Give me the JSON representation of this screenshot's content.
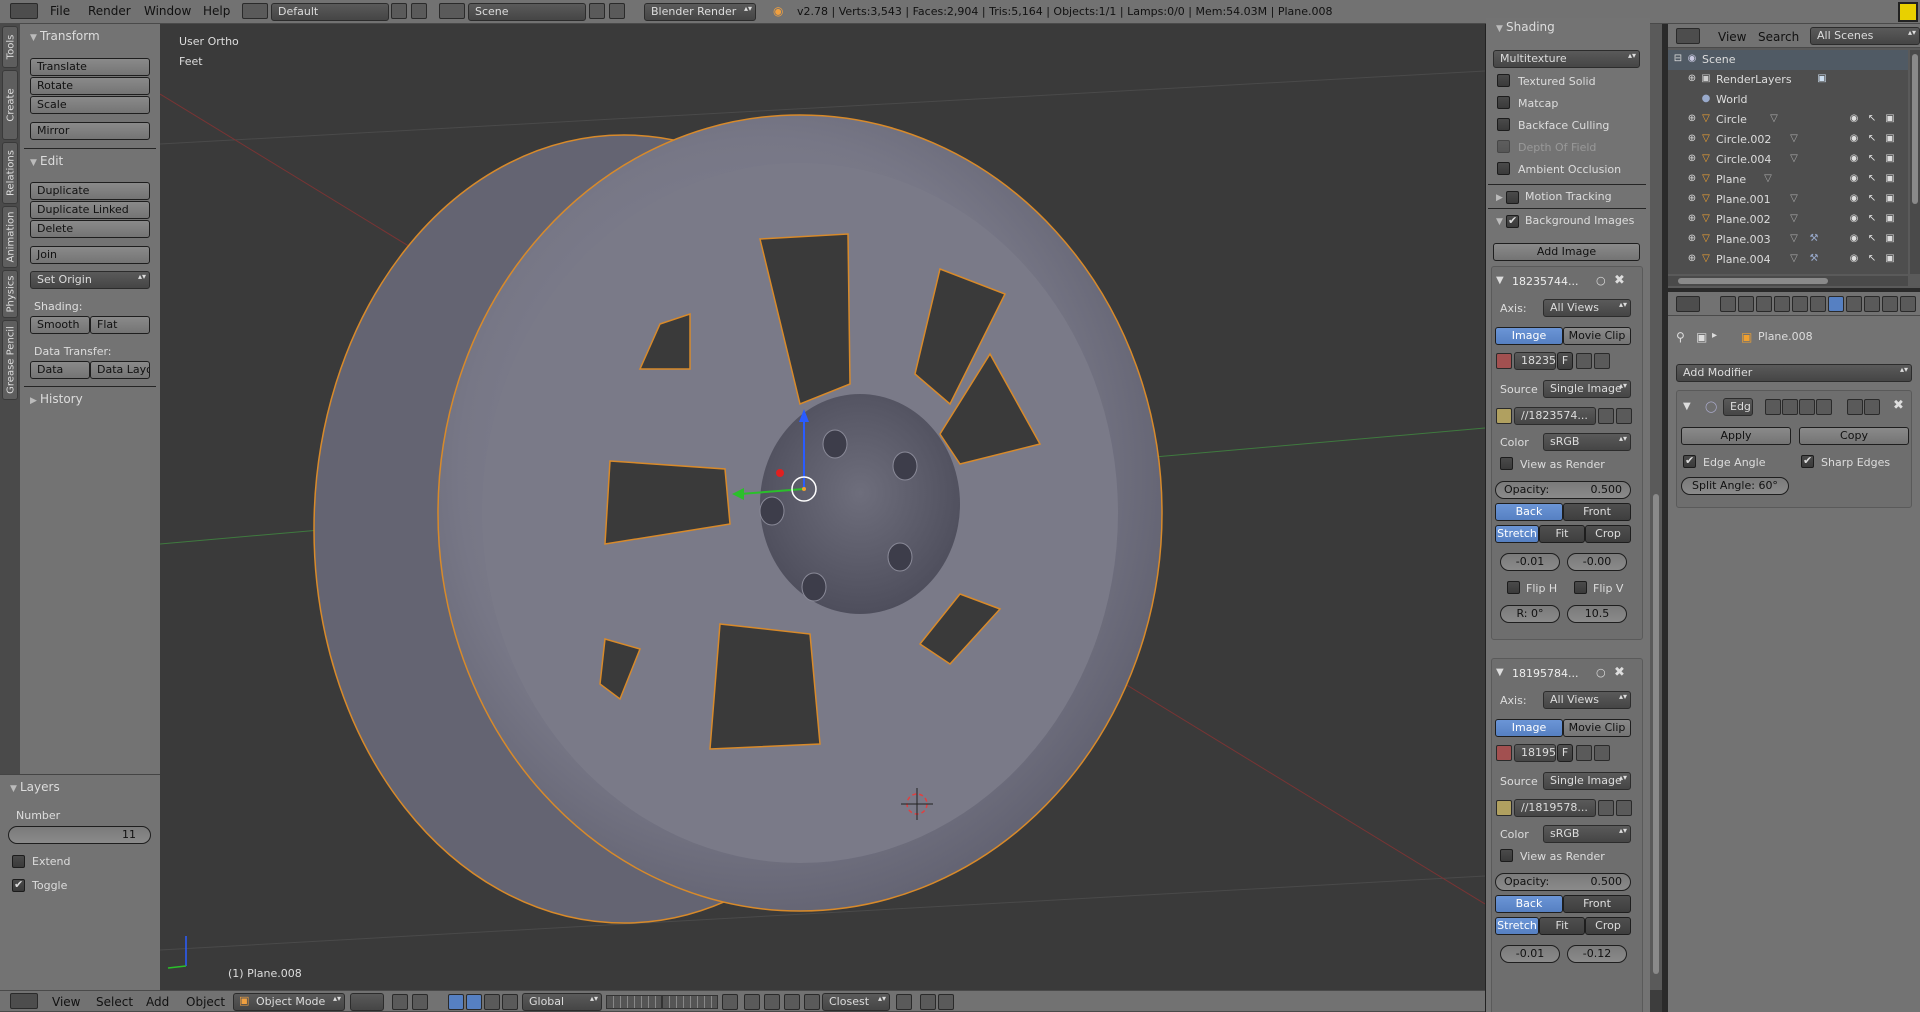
{
  "top_bar": {
    "menus": [
      "File",
      "Render",
      "Window",
      "Help"
    ],
    "layout": "Default",
    "scene": "Scene",
    "engine": "Blender Render",
    "stats": "v2.78 | Verts:3,543 | Faces:2,904 | Tris:5,164 | Objects:1/1 | Lamps:0/0 | Mem:54.03M | Plane.008"
  },
  "tool_tabs": [
    "Tools",
    "Create",
    "Relations",
    "Animation",
    "Physics",
    "Grease Pencil"
  ],
  "tool_shelf": {
    "transform": {
      "title": "Transform",
      "buttons": [
        "Translate",
        "Rotate",
        "Scale",
        "Mirror"
      ]
    },
    "edit": {
      "title": "Edit",
      "buttons": [
        "Duplicate",
        "Duplicate Linked",
        "Delete",
        "Join"
      ],
      "set_origin": "Set Origin",
      "shading_label": "Shading:",
      "smooth": "Smooth",
      "flat": "Flat",
      "data_transfer_label": "Data Transfer:",
      "data": "Data",
      "data_layout": "Data Layo"
    },
    "history": "History"
  },
  "layers_panel": {
    "title": "Layers",
    "number_label": "Number",
    "number_value": "11",
    "extend": "Extend",
    "toggle": "Toggle"
  },
  "viewport": {
    "view_name": "User Ortho",
    "units": "Feet",
    "object_label": "(1) Plane.008"
  },
  "bottom_bar": {
    "menus": [
      "View",
      "Select",
      "Add",
      "Object"
    ],
    "mode": "Object Mode",
    "orientation": "Global",
    "snap": "Closest"
  },
  "properties": {
    "shading_title": "Shading",
    "shading_mode": "Multitexture",
    "options": [
      {
        "label": "Textured Solid",
        "checked": false
      },
      {
        "label": "Matcap",
        "checked": false
      },
      {
        "label": "Backface Culling",
        "checked": false
      },
      {
        "label": "Depth Of Field",
        "checked": false,
        "disabled": true
      },
      {
        "label": "Ambient Occlusion",
        "checked": false
      }
    ],
    "motion_tracking": "Motion Tracking",
    "background_images": "Background Images",
    "add_image": "Add Image",
    "images": [
      {
        "name": "18235744...",
        "axis_label": "Axis:",
        "axis": "All Views",
        "tab_image": "Image",
        "tab_movie": "Movie Clip",
        "datablock": "18235",
        "f": "F",
        "source_label": "Source",
        "source": "Single Image",
        "path": "//1823574...",
        "color_label": "Color",
        "color": "sRGB",
        "view_as_render": "View as Render",
        "opacity": "Opacity:",
        "opacity_value": "0.500",
        "back": "Back",
        "front": "Front",
        "stretch": "Stretch",
        "fit": "Fit",
        "crop": "Crop",
        "off_x": "-0.01",
        "off_y": "-0.00",
        "flip_h": "Flip H",
        "flip_v": "Flip V",
        "rotation": "R: 0°",
        "size": "10.5"
      },
      {
        "name": "18195784...",
        "axis_label": "Axis:",
        "axis": "All Views",
        "tab_image": "Image",
        "tab_movie": "Movie Clip",
        "datablock": "18195",
        "f": "F",
        "source_label": "Source",
        "source": "Single Image",
        "path": "//1819578...",
        "color_label": "Color",
        "color": "sRGB",
        "view_as_render": "View as Render",
        "opacity": "Opacity:",
        "opacity_value": "0.500",
        "back": "Back",
        "front": "Front",
        "stretch": "Stretch",
        "fit": "Fit",
        "crop": "Crop",
        "off_x": "-0.01",
        "off_y": "-0.12"
      }
    ]
  },
  "outliner": {
    "menus": [
      "View",
      "Search"
    ],
    "filter": "All Scenes",
    "items": [
      {
        "name": "Scene",
        "indent": 0,
        "icon": "scene-icon"
      },
      {
        "name": "RenderLayers",
        "indent": 1,
        "icon": "render-layers-icon"
      },
      {
        "name": "World",
        "indent": 1,
        "icon": "world-icon"
      },
      {
        "name": "Circle",
        "indent": 1,
        "icon": "object-icon"
      },
      {
        "name": "Circle.002",
        "indent": 1,
        "icon": "object-icon"
      },
      {
        "name": "Circle.004",
        "indent": 1,
        "icon": "object-icon"
      },
      {
        "name": "Plane",
        "indent": 1,
        "icon": "object-icon"
      },
      {
        "name": "Plane.001",
        "indent": 1,
        "icon": "object-icon"
      },
      {
        "name": "Plane.002",
        "indent": 1,
        "icon": "object-icon"
      },
      {
        "name": "Plane.003",
        "indent": 1,
        "icon": "object-icon"
      },
      {
        "name": "Plane.004",
        "indent": 1,
        "icon": "object-icon"
      }
    ]
  },
  "modifier_panel": {
    "object": "Plane.008",
    "add_modifier": "Add Modifier",
    "modifier_name": "Edg",
    "apply": "Apply",
    "copy": "Copy",
    "edge_angle": "Edge Angle",
    "sharp_edges": "Sharp Edges",
    "split_angle": "Split Angle: 60°"
  }
}
